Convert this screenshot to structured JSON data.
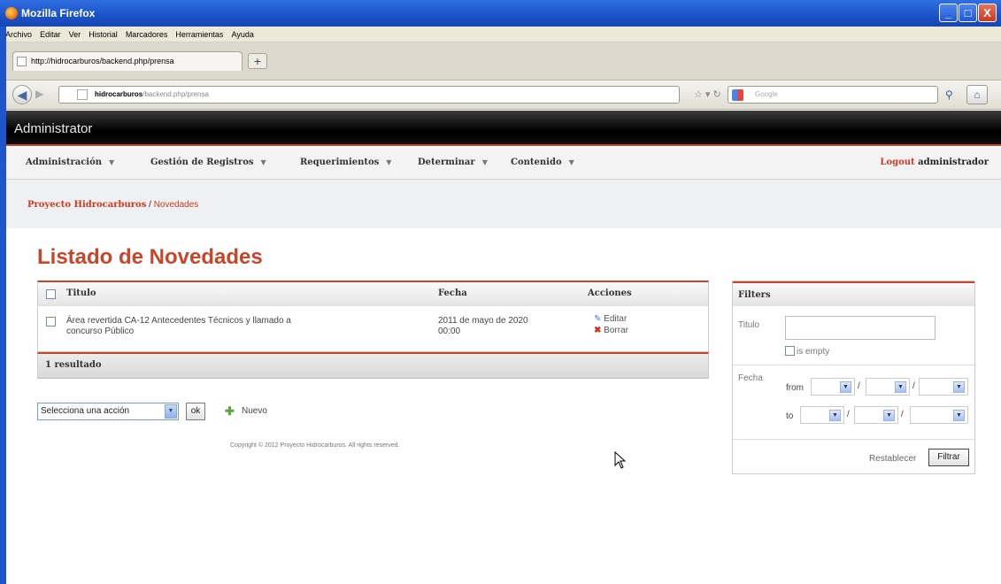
{
  "window": {
    "title": "Mozilla Firefox",
    "minimize": "_",
    "maximize": "□",
    "close": "X"
  },
  "menubar": [
    "Archivo",
    "Editar",
    "Ver",
    "Historial",
    "Marcadores",
    "Herramientas",
    "Ayuda"
  ],
  "tab": {
    "title": "http://hidrocarburos/backend.php/prensa",
    "newtab": "+"
  },
  "navbar": {
    "url_host": "hidrocarburos",
    "url_path": "/backend.php/prensa",
    "search_placeholder": "Google"
  },
  "admin": {
    "title": "Administrator"
  },
  "mainmenu": {
    "items": [
      "Administración",
      "Gestión de Registros",
      "Requerimientos",
      "Determinar",
      "Contenido"
    ],
    "logout": "Logout",
    "user": "administrador"
  },
  "breadcrumb": {
    "parent": "Proyecto Hidrocarburos",
    "sep": " / ",
    "current": "Novedades"
  },
  "page": {
    "title": "Listado de Novedades"
  },
  "table": {
    "headers": {
      "titulo": "Titulo",
      "fecha": "Fecha",
      "acciones": "Acciones"
    },
    "rows": [
      {
        "titulo_line1": "Área revertida CA-12 Antecedentes Técnicos y llamado a",
        "titulo_line2": "concurso Público",
        "fecha_line1": "2011 de mayo de 2020",
        "fecha_line2": "00:00",
        "edit": "Editar",
        "delete": "Borrar"
      }
    ],
    "footer": "1 resultado"
  },
  "batch": {
    "select_value": "Selecciona una acción",
    "ok": "ok",
    "new": "Nuevo"
  },
  "copyright": "Copyright © 2012 Proyecto Hidrocarburos. All rights reserved.",
  "filters": {
    "title": "Filters",
    "titulo_label": "Titulo",
    "is_empty": "is empty",
    "fecha_label": "Fecha",
    "from": "from",
    "to": "to",
    "date_sep": "/",
    "reset": "Restablecer",
    "submit": "Filtrar"
  },
  "colors": {
    "accent": "#c8452a",
    "adminbar": "#000000",
    "titlebar": "#1c52c8"
  }
}
